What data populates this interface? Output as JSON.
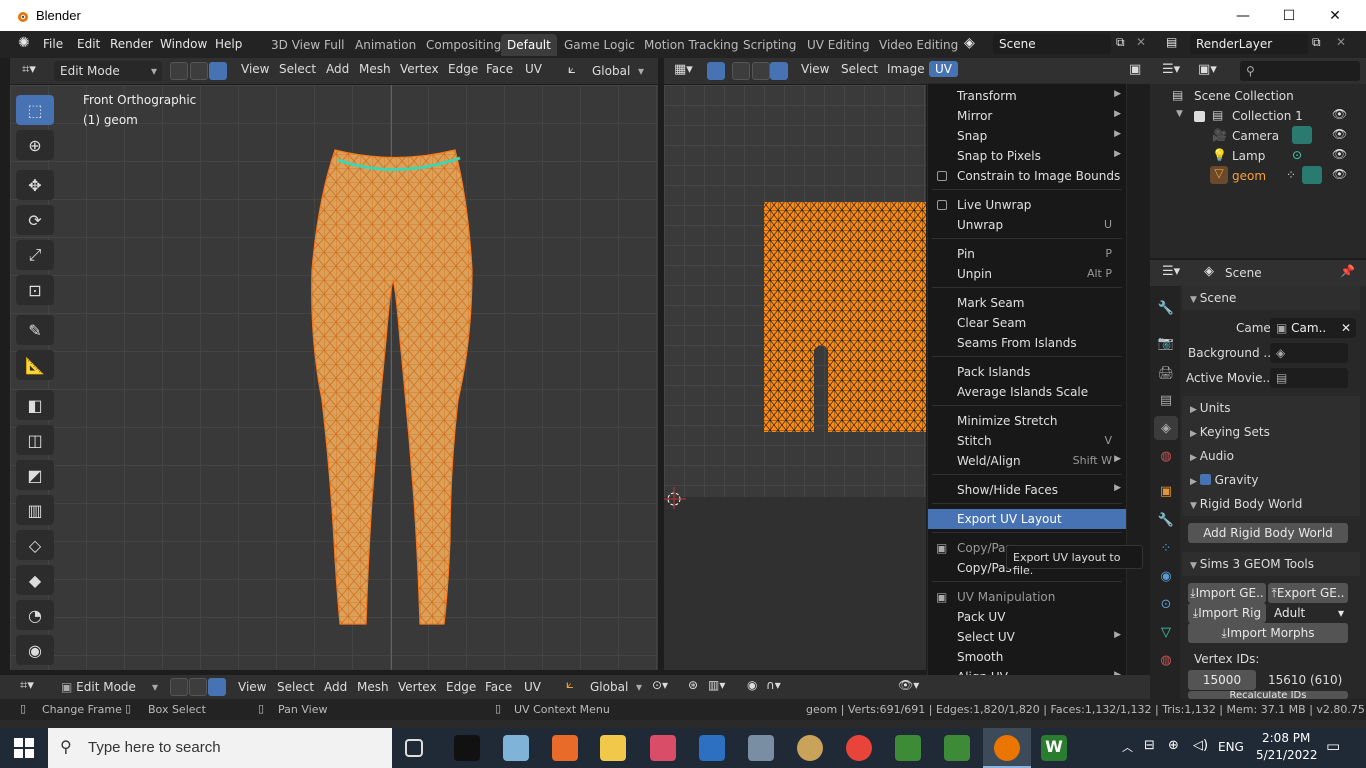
{
  "window": {
    "title": "Blender",
    "controls": [
      "—",
      "☐",
      "✕"
    ]
  },
  "menubar": [
    "File",
    "Edit",
    "Render",
    "Window",
    "Help"
  ],
  "workspaces": [
    "3D View Full",
    "Animation",
    "Compositing",
    "Default",
    "Game Logic",
    "Motion Tracking",
    "Scripting",
    "UV Editing",
    "Video Editing"
  ],
  "active_workspace": "Default",
  "scene_field": "Scene",
  "renderlayer_field": "RenderLayer",
  "view3d": {
    "mode": "Edit Mode",
    "menus": [
      "View",
      "Select",
      "Add",
      "Mesh",
      "Vertex",
      "Edge",
      "Face",
      "UV"
    ],
    "orientation": "Global",
    "overlay_title": "Front Orthographic",
    "overlay_object": "(1) geom"
  },
  "uv_editor": {
    "menus": [
      "View",
      "Select",
      "Image",
      "UV"
    ]
  },
  "uv_menu": {
    "items": [
      {
        "label": "Transform",
        "shortcut": "",
        "submenu": true
      },
      {
        "label": "Mirror",
        "shortcut": "",
        "submenu": true
      },
      {
        "label": "Snap",
        "shortcut": "",
        "submenu": true
      },
      {
        "label": "Snap to Pixels",
        "shortcut": "",
        "submenu": true
      },
      {
        "label": "Constrain to Image Bounds",
        "shortcut": "",
        "checkbox": true
      },
      {
        "label": "Live Unwrap",
        "shortcut": "",
        "checkbox": true
      },
      {
        "label": "Unwrap",
        "shortcut": "U"
      },
      {
        "label": "Pin",
        "shortcut": "P"
      },
      {
        "label": "Unpin",
        "shortcut": "Alt P"
      },
      {
        "label": "Mark Seam",
        "shortcut": ""
      },
      {
        "label": "Clear Seam",
        "shortcut": ""
      },
      {
        "label": "Seams From Islands",
        "shortcut": ""
      },
      {
        "label": "Pack Islands",
        "shortcut": ""
      },
      {
        "label": "Average Islands Scale",
        "shortcut": ""
      },
      {
        "label": "Minimize Stretch",
        "shortcut": ""
      },
      {
        "label": "Stitch",
        "shortcut": "V"
      },
      {
        "label": "Weld/Align",
        "shortcut": "Shift W",
        "submenu": true
      },
      {
        "label": "Show/Hide Faces",
        "shortcut": "",
        "submenu": true
      },
      {
        "label": "Export UV Layout",
        "shortcut": "",
        "highlighted": true
      },
      {
        "label": "Copy/Pas",
        "shortcut": ""
      },
      {
        "label": "Copy/Pas",
        "shortcut": ""
      },
      {
        "label": "UV Manipulation",
        "shortcut": ""
      },
      {
        "label": "Pack UV",
        "shortcut": ""
      },
      {
        "label": "Select UV",
        "shortcut": "",
        "submenu": true
      },
      {
        "label": "Smooth",
        "shortcut": ""
      },
      {
        "label": "Align UV",
        "shortcut": "",
        "submenu": true
      }
    ],
    "tooltip": "Export UV layout to file."
  },
  "outliner": {
    "rows": [
      "Scene Collection",
      "Collection 1",
      "Camera",
      "Lamp",
      "geom"
    ]
  },
  "properties": {
    "header": "Scene",
    "scene_panel": "Scene",
    "camera_label": "Camera",
    "camera_value": "Cam..",
    "background_label": "Background ..",
    "active_movie_label": "Active Movie..",
    "panels": [
      "Units",
      "Keying Sets",
      "Audio",
      "Gravity",
      "Rigid Body World"
    ],
    "add_rigid_body": "Add Rigid Body World",
    "sims_panel": "Sims 3 GEOM Tools",
    "import_geom": "Import GE..",
    "export_geom": "Export GE..",
    "import_rig": "Import Rig",
    "rig_select": "Adult",
    "import_morphs": "Import Morphs",
    "vertex_ids_label": "Vertex IDs:",
    "vertex_id_a": "15000",
    "vertex_id_b": "15610 (610)",
    "recalc": "Recalculate IDs"
  },
  "bottom_header": {
    "mode": "Edit Mode",
    "menus": [
      "View",
      "Select",
      "Add",
      "Mesh",
      "Vertex",
      "Edge",
      "Face",
      "UV"
    ],
    "orientation": "Global"
  },
  "statusbar": {
    "change_frame": "Change Frame",
    "box_select": "Box Select",
    "pan_view": "Pan View",
    "uv_context": "UV Context Menu",
    "stats": "geom | Verts:691/691 | Edges:1,820/1,820 | Faces:1,132/1,132 | Tris:1,132 | Mem: 37.1 MB | v2.80.75"
  },
  "taskbar": {
    "search_placeholder": "Type here to search",
    "lang": "ENG",
    "time": "2:08 PM",
    "date": "5/21/2022"
  },
  "colors": {
    "accent": "#4772b3",
    "mesh": "#e0a14a",
    "wire": "#ff7a1a",
    "seam": "#3ed6b2"
  }
}
